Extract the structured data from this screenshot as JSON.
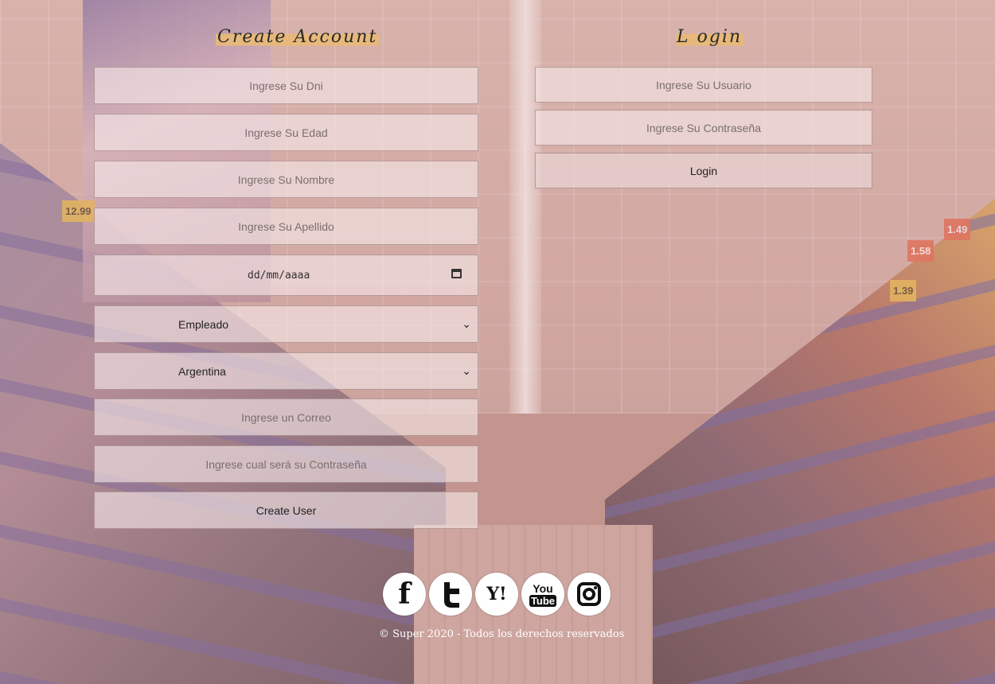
{
  "create_account": {
    "title": "Create Account",
    "dni_placeholder": "Ingrese Su Dni",
    "edad_placeholder": "Ingrese Su Edad",
    "nombre_placeholder": "Ingrese Su Nombre",
    "apellido_placeholder": "Ingrese Su Apellido",
    "date_placeholder": "dd/mm/aaaa",
    "role_selected": "Empleado",
    "country_selected": "Argentina",
    "correo_placeholder": "Ingrese un Correo",
    "password_placeholder": "Ingrese cual será su Contraseña",
    "submit_label": "Create User"
  },
  "login": {
    "title": "L ogin",
    "user_placeholder": "Ingrese Su Usuario",
    "password_placeholder": "Ingrese Su Contraseña",
    "submit_label": "Login"
  },
  "social": {
    "facebook": "f",
    "yahoo": "Y!",
    "youtube_top": "You",
    "youtube_bottom": "Tube"
  },
  "footer": {
    "text": "© Super 2020 - Todos los derechos reservados"
  },
  "background": {
    "price_tags": [
      "12.99",
      "1.49",
      "1.58",
      "1.39"
    ]
  }
}
